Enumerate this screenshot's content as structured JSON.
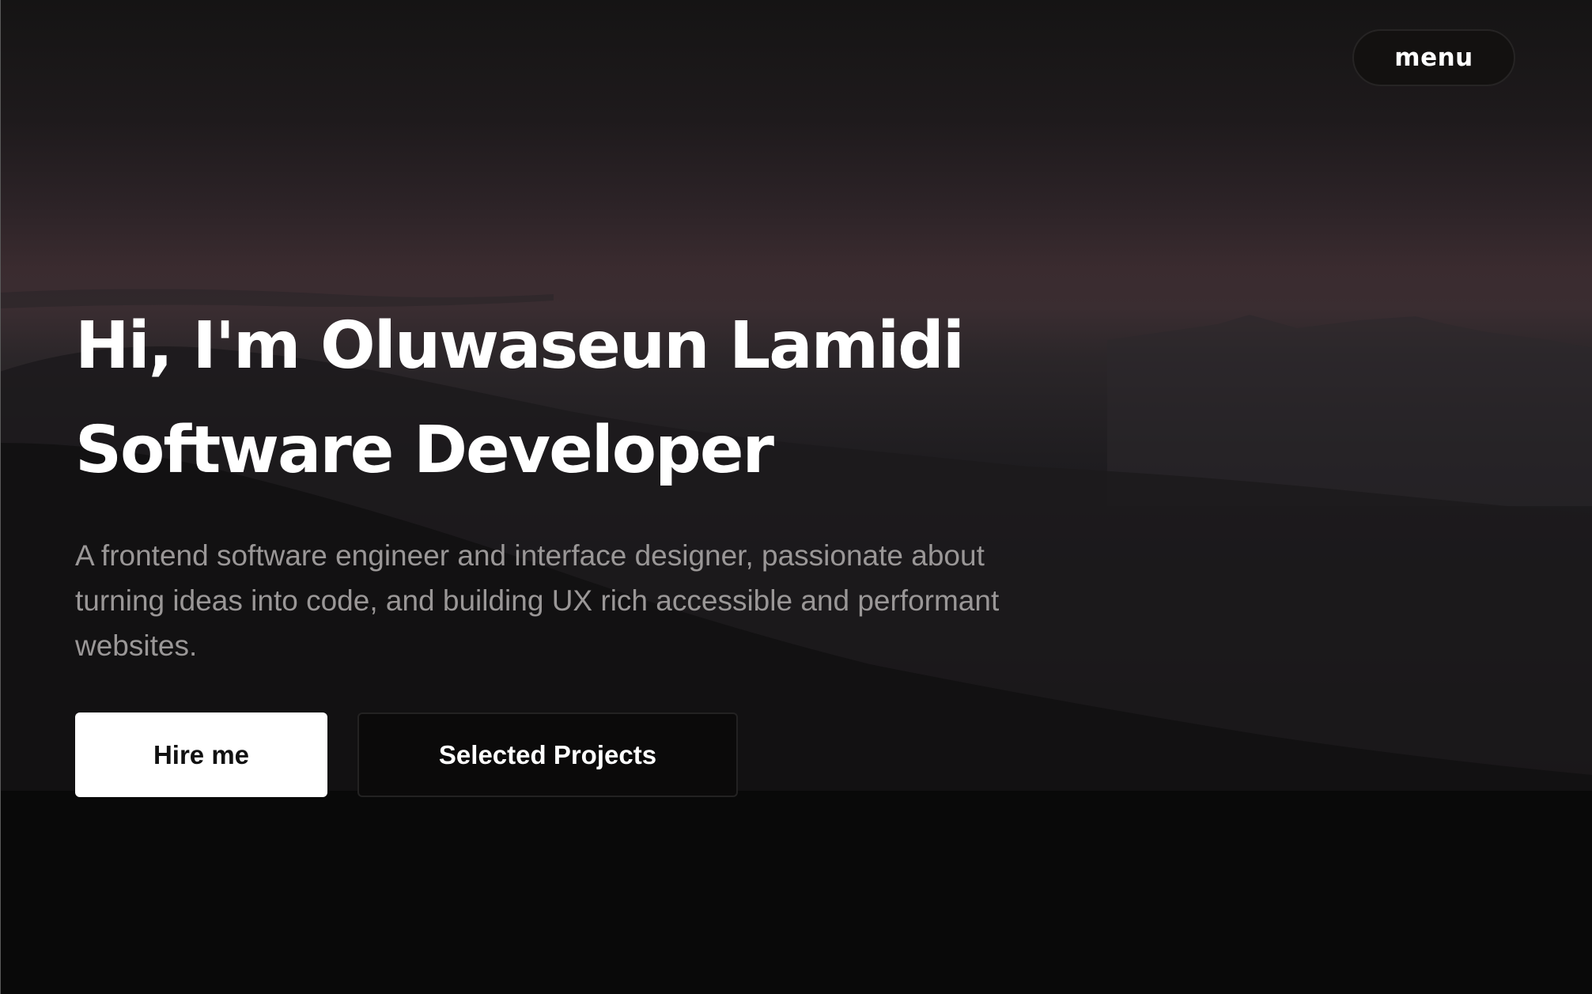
{
  "header": {
    "menu_label": "menu"
  },
  "hero": {
    "title_line1": "Hi, I'm Oluwaseun Lamidi",
    "title_line2": "Software Developer",
    "description": "A frontend software engineer and interface designer, passionate about turning ideas into code, and building UX rich accessible and performant websites."
  },
  "actions": {
    "hire_label": "Hire me",
    "projects_label": "Selected Projects"
  },
  "colors": {
    "background_dark": "#0a0909",
    "sky_purple": "#3a2b2f",
    "text_primary": "#ffffff",
    "text_muted": "#9a9797"
  }
}
